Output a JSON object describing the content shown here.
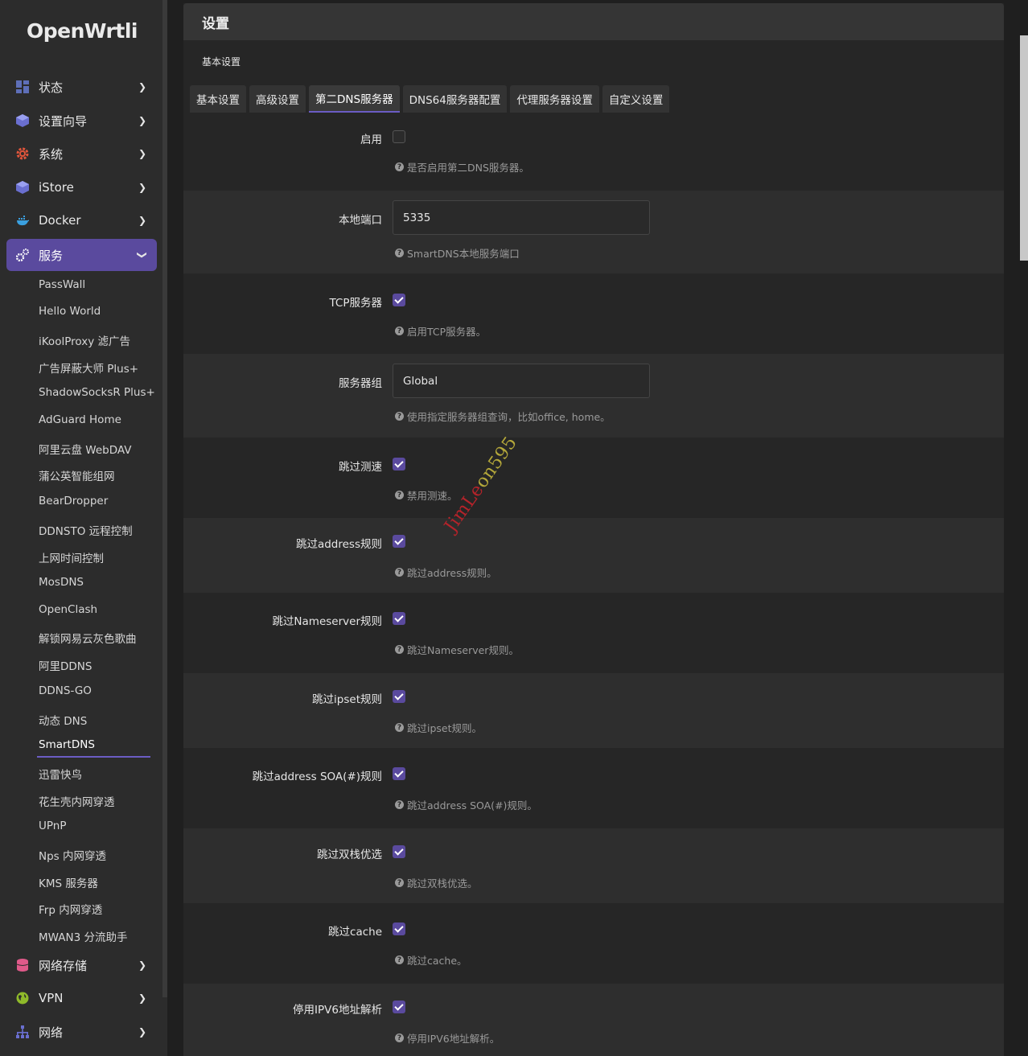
{
  "app": {
    "logo": "OpenWrtli"
  },
  "sidebar": {
    "menu": [
      {
        "label": "状态",
        "icon": "dashboard-icon"
      },
      {
        "label": "设置向导",
        "icon": "cube-icon"
      },
      {
        "label": "系统",
        "icon": "gear-icon"
      },
      {
        "label": "iStore",
        "icon": "cube-icon"
      },
      {
        "label": "Docker",
        "icon": "docker-icon"
      },
      {
        "label": "服务",
        "icon": "cogs-icon"
      }
    ],
    "services": [
      "PassWall",
      "Hello World",
      "iKoolProxy 滤广告",
      "广告屏蔽大师 Plus+",
      "ShadowSocksR Plus+",
      "AdGuard Home",
      "阿里云盘 WebDAV",
      "蒲公英智能组网",
      "BearDropper",
      "DDNSTO 远程控制",
      "上网时间控制",
      "MosDNS",
      "OpenClash",
      "解锁网易云灰色歌曲",
      "阿里DDNS",
      "DDNS-GO",
      "动态 DNS",
      "SmartDNS",
      "迅雷快鸟",
      "花生壳内网穿透",
      "UPnP",
      "Nps 内网穿透",
      "KMS 服务器",
      "Frp 内网穿透",
      "MWAN3 分流助手"
    ],
    "bottom_menu": [
      {
        "label": "网络存储",
        "icon": "database-icon"
      },
      {
        "label": "VPN",
        "icon": "globe-icon"
      },
      {
        "label": "网络",
        "icon": "network-icon"
      }
    ],
    "accent": "#5a4a9e"
  },
  "main": {
    "title": "设置",
    "section": "基本设置",
    "tabs": [
      "基本设置",
      "高级设置",
      "第二DNS服务器",
      "DNS64服务器配置",
      "代理服务器设置",
      "自定义设置"
    ],
    "active_tab": "第二DNS服务器",
    "fields": [
      {
        "label": "启用",
        "type": "checkbox",
        "checked": false,
        "help": "是否启用第二DNS服务器。"
      },
      {
        "label": "本地端口",
        "type": "text",
        "value": "5335",
        "help": "SmartDNS本地服务端口"
      },
      {
        "label": "TCP服务器",
        "type": "checkbox",
        "checked": true,
        "help": "启用TCP服务器。"
      },
      {
        "label": "服务器组",
        "type": "text",
        "value": "Global",
        "help": "使用指定服务器组查询，比如office, home。"
      },
      {
        "label": "跳过测速",
        "type": "checkbox",
        "checked": true,
        "help": "禁用测速。"
      },
      {
        "label": "跳过address规则",
        "type": "checkbox",
        "checked": true,
        "help": "跳过address规则。"
      },
      {
        "label": "跳过Nameserver规则",
        "type": "checkbox",
        "checked": true,
        "help": "跳过Nameserver规则。"
      },
      {
        "label": "跳过ipset规则",
        "type": "checkbox",
        "checked": true,
        "help": "跳过ipset规则。"
      },
      {
        "label": "跳过address SOA(#)规则",
        "type": "checkbox",
        "checked": true,
        "help": "跳过address SOA(#)规则。"
      },
      {
        "label": "跳过双栈优选",
        "type": "checkbox",
        "checked": true,
        "help": "跳过双栈优选。"
      },
      {
        "label": "跳过cache",
        "type": "checkbox",
        "checked": true,
        "help": "跳过cache。"
      },
      {
        "label": "停用IPV6地址解析",
        "type": "checkbox",
        "checked": true,
        "help": "停用IPV6地址解析。"
      }
    ]
  },
  "watermark": {
    "part1": "JimLe",
    "part2": "on595"
  }
}
